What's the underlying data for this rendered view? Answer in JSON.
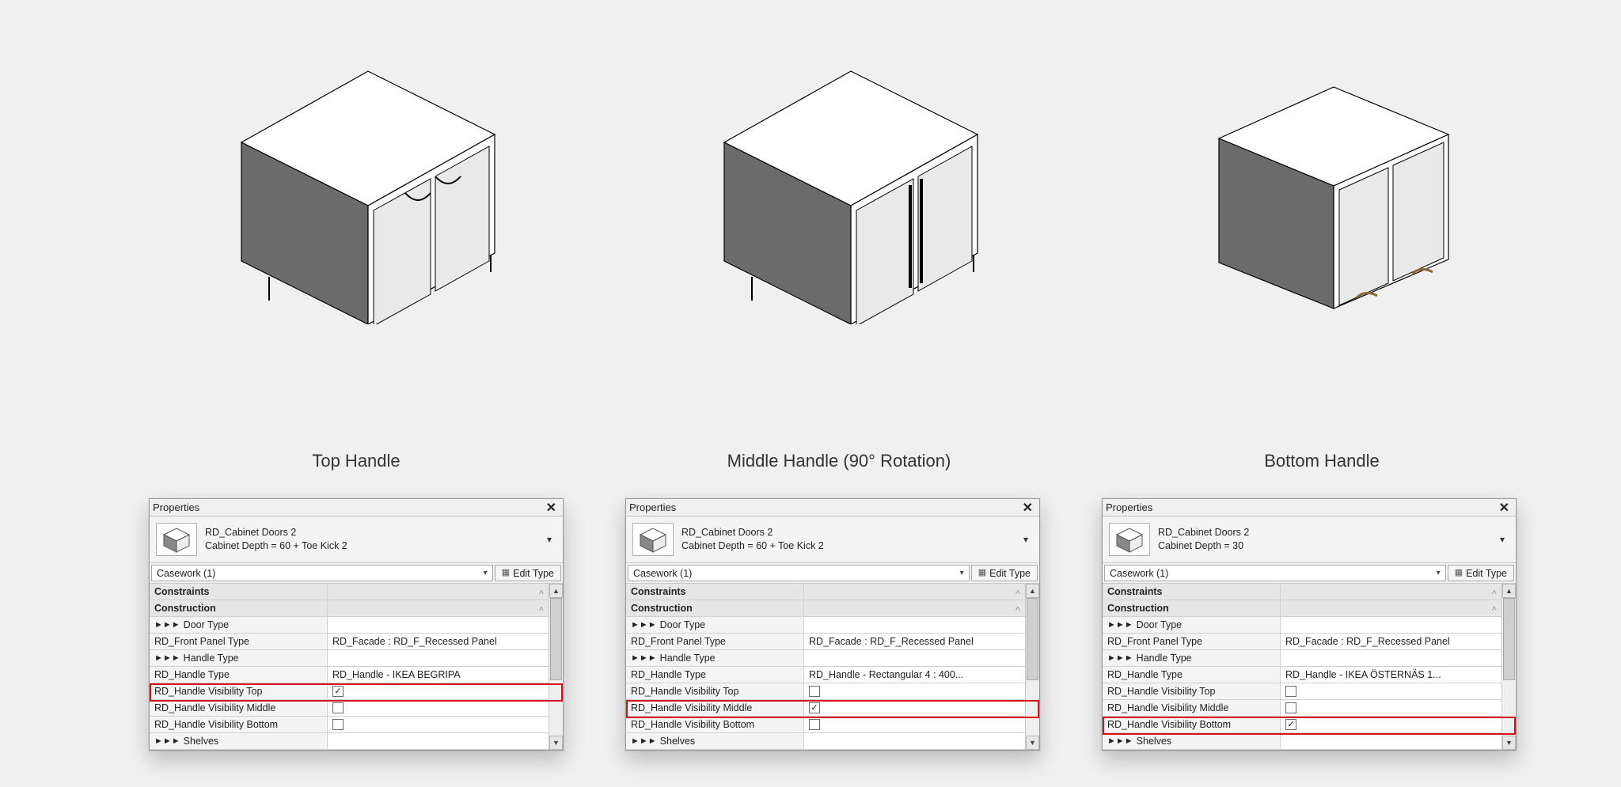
{
  "captions": {
    "left": "Top Handle",
    "middle": "Middle Handle (90° Rotation)",
    "right": "Bottom Handle"
  },
  "panels": [
    {
      "id": "left",
      "title": "Properties",
      "family_name": "RD_Cabinet Doors 2",
      "family_type": "Cabinet Depth = 60 + Toe Kick 2",
      "filter": "Casework (1)",
      "edit_type_label": "Edit Type",
      "highlight_param": "RD_Handle Visibility Top",
      "groups": [
        {
          "kind": "header",
          "label": "Constraints"
        },
        {
          "kind": "header",
          "label": "Construction"
        },
        {
          "kind": "link",
          "label": "Door Type"
        },
        {
          "kind": "param",
          "label": "RD_Front Panel Type<Casework>",
          "value": "RD_Facade : RD_F_Recessed Panel"
        },
        {
          "kind": "link",
          "label": "Handle Type"
        },
        {
          "kind": "param",
          "label": "RD_Handle Type<Casework>",
          "value": "RD_Handle - IKEA BEGRIPA"
        },
        {
          "kind": "check",
          "label": "RD_Handle Visibility Top",
          "checked": true
        },
        {
          "kind": "check",
          "label": "RD_Handle Visibility Middle",
          "checked": false
        },
        {
          "kind": "check",
          "label": "RD_Handle Visibility Bottom",
          "checked": false
        },
        {
          "kind": "link",
          "label": "Shelves"
        }
      ]
    },
    {
      "id": "middle",
      "title": "Properties",
      "family_name": "RD_Cabinet Doors 2",
      "family_type": "Cabinet Depth = 60 + Toe Kick 2",
      "filter": "Casework (1)",
      "edit_type_label": "Edit Type",
      "highlight_param": "RD_Handle Visibility Middle",
      "groups": [
        {
          "kind": "header",
          "label": "Constraints"
        },
        {
          "kind": "header",
          "label": "Construction"
        },
        {
          "kind": "link",
          "label": "Door Type"
        },
        {
          "kind": "param",
          "label": "RD_Front Panel Type<Casework>",
          "value": "RD_Facade : RD_F_Recessed Panel"
        },
        {
          "kind": "link",
          "label": "Handle Type"
        },
        {
          "kind": "param",
          "label": "RD_Handle Type<Casework>",
          "value": "RD_Handle - Rectangular 4 : 400..."
        },
        {
          "kind": "check",
          "label": "RD_Handle Visibility Top",
          "checked": false
        },
        {
          "kind": "check",
          "label": "RD_Handle Visibility Middle",
          "checked": true
        },
        {
          "kind": "check",
          "label": "RD_Handle Visibility Bottom",
          "checked": false
        },
        {
          "kind": "link",
          "label": "Shelves"
        }
      ]
    },
    {
      "id": "right",
      "title": "Properties",
      "family_name": "RD_Cabinet Doors 2",
      "family_type": "Cabinet Depth = 30",
      "filter": "Casework (1)",
      "edit_type_label": "Edit Type",
      "highlight_param": "RD_Handle Visibility Bottom",
      "groups": [
        {
          "kind": "header",
          "label": "Constraints"
        },
        {
          "kind": "header",
          "label": "Construction"
        },
        {
          "kind": "link",
          "label": "Door Type"
        },
        {
          "kind": "param",
          "label": "RD_Front Panel Type<Casework>",
          "value": "RD_Facade : RD_F_Recessed Panel"
        },
        {
          "kind": "link",
          "label": "Handle Type"
        },
        {
          "kind": "param",
          "label": "RD_Handle Type<Casework>",
          "value": "RD_Handle - IKEA ÖSTERNÄS 1..."
        },
        {
          "kind": "check",
          "label": "RD_Handle Visibility Top",
          "checked": false
        },
        {
          "kind": "check",
          "label": "RD_Handle Visibility Middle",
          "checked": false
        },
        {
          "kind": "check",
          "label": "RD_Handle Visibility Bottom",
          "checked": true
        },
        {
          "kind": "link",
          "label": "Shelves"
        }
      ]
    }
  ]
}
